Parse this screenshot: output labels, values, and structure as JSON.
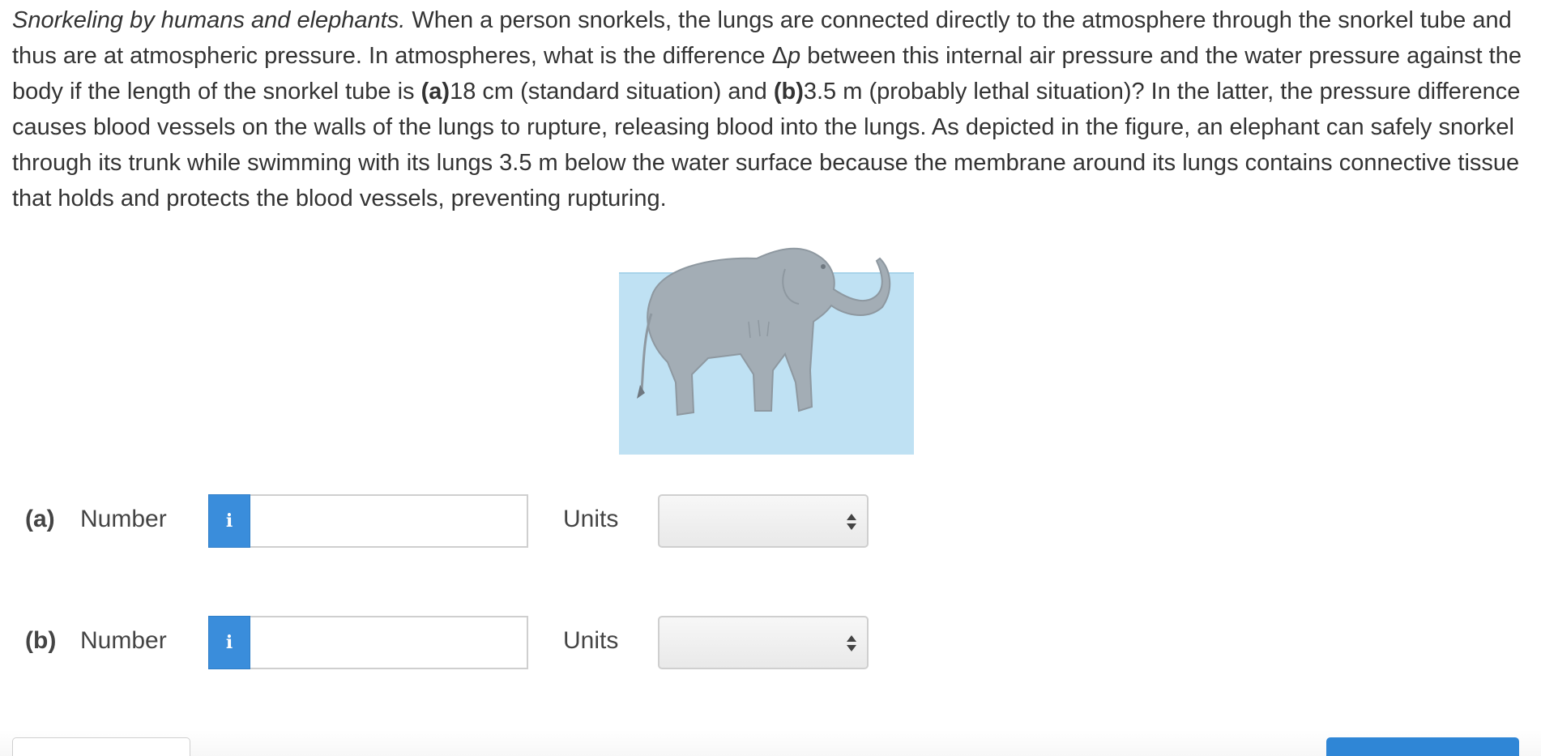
{
  "problem": {
    "lead": "Snorkeling by humans and elephants.",
    "text_1": " When a person snorkels, the lungs are connected directly to the atmosphere through the snorkel tube and thus are at atmospheric pressure. In atmospheres, what is the difference Δ",
    "delta_symbol": "p",
    "text_2": " between this internal air pressure and the water pressure against the body if the length of the snorkel tube is ",
    "part_a_marker": "(a)",
    "part_a_value": "18 cm (standard situation) and ",
    "part_b_marker": "(b)",
    "part_b_value": "3.5 m (probably lethal situation)? In the latter, the pressure difference causes blood vessels on the walls of the lungs to rupture, releasing blood into the lungs. As depicted in the figure, an elephant can safely snorkel through its trunk while swimming with its lungs 3.5 m below the water surface because the membrane around its lungs contains connective tissue that holds and protects the blood vessels, preventing rupturing."
  },
  "figure": {
    "water_color": "#bfe1f3",
    "elephant_color": "#a3adb5",
    "icon": "elephant-snorkeling-figure"
  },
  "answers": [
    {
      "part_label": "(a)",
      "number_label": "Number",
      "info_icon_glyph": "i",
      "number_value": "",
      "units_label": "Units",
      "units_selected": ""
    },
    {
      "part_label": "(b)",
      "number_label": "Number",
      "info_icon_glyph": "i",
      "number_value": "",
      "units_label": "Units",
      "units_selected": ""
    }
  ],
  "colors": {
    "info_button": "#3a8ddb",
    "primary_button": "#2f86d6",
    "text": "#333333"
  }
}
